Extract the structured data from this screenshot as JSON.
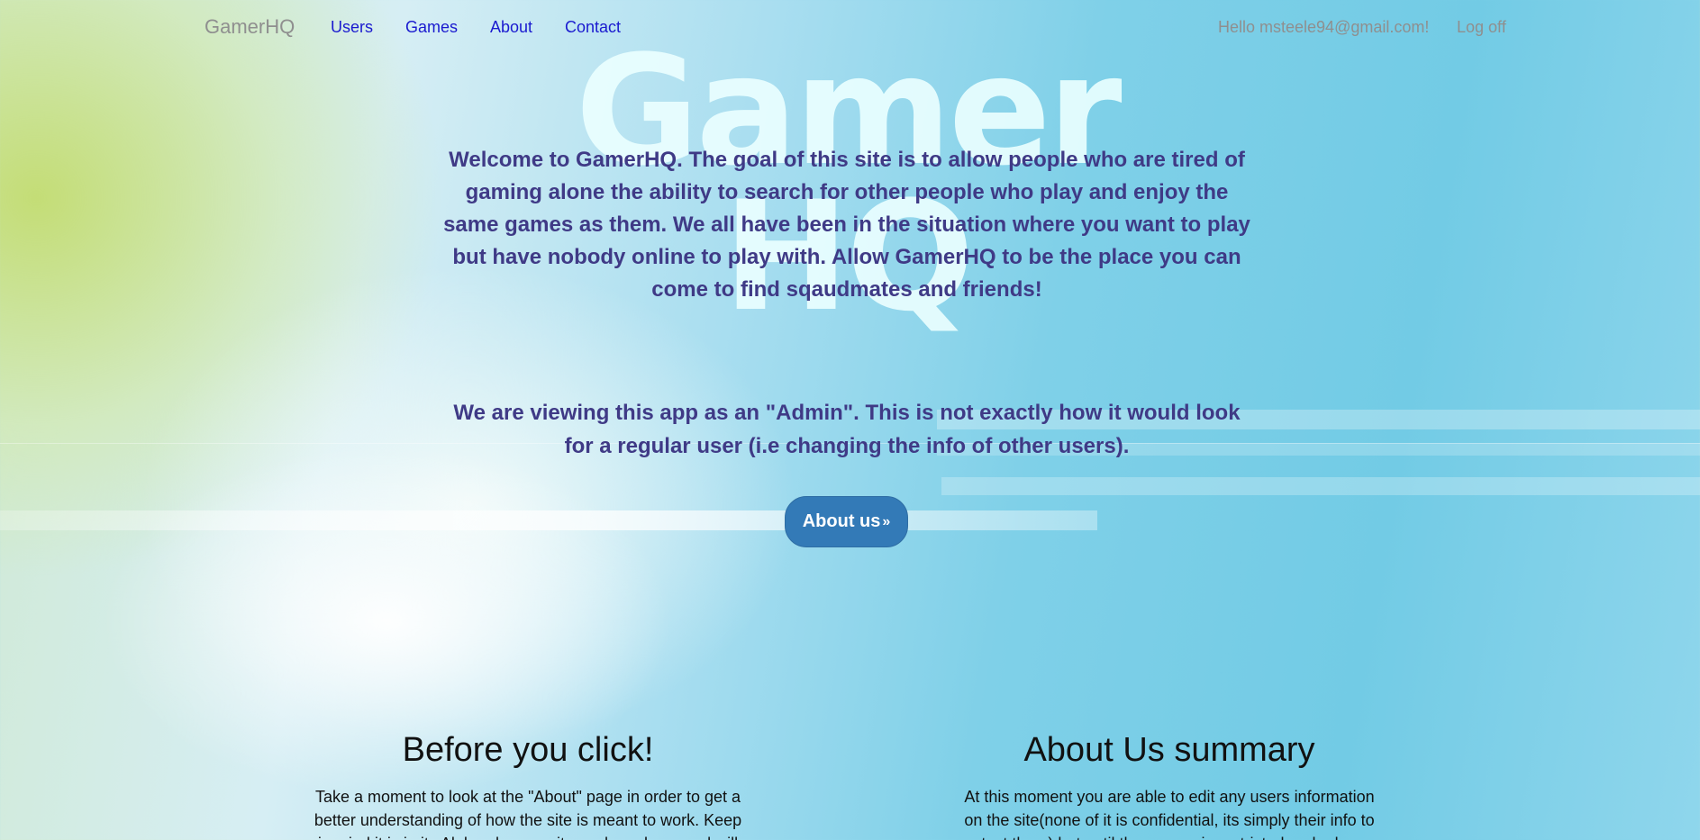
{
  "nav": {
    "brand": "GamerHQ",
    "links": [
      "Users",
      "Games",
      "About",
      "Contact"
    ],
    "hello": "Hello msteele94@gmail.com!",
    "logoff": "Log off"
  },
  "hero": {
    "logo_line1": "Gamer",
    "logo_line2": "HQ",
    "welcome": "Welcome to GamerHQ. The goal of this site is to allow people who are tired of gaming alone the ability to search for other people who play and enjoy the same games as them. We all have been in the situation where you want to play but have nobody online to play with. Allow GamerHQ to be the place you can come to find sqaudmates and friends!",
    "admin_note": "We are viewing this app as an \"Admin\". This is not exactly how it would look for a regular user (i.e changing the info of other users).",
    "about_button": "About us",
    "about_button_arrow": "»"
  },
  "columns": [
    {
      "title": "Before you click!",
      "text": "Take a moment to look at the \"About\" page in order to get a better understanding of how the site is meant to work. Keep in mind it is in its Alpha phase so it may have bugs and will"
    },
    {
      "title": "About Us summary",
      "text": "At this moment you are able to edit any users information on the site(none of it is confidential, its simply their info to contact them) but until the access is restricted and roles are"
    }
  ],
  "colors": {
    "link": "#1a1acf",
    "muted": "#8f8f8f",
    "hero_text": "#3f3a86",
    "button": "#337ab7"
  }
}
